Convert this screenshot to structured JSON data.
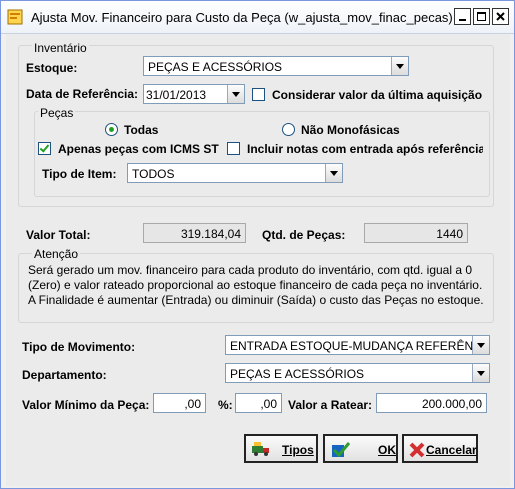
{
  "window": {
    "title": "Ajusta Mov. Financeiro para Custo da Peça (w_ajusta_mov_finac_pecas)"
  },
  "inventario": {
    "group_label": "Inventário",
    "estoque_label": "Estoque:",
    "estoque_value": "PEÇAS E ACESSÓRIOS",
    "data_ref_label": "Data de Referência:",
    "data_ref_value": "31/01/2013",
    "considerar_label": "Considerar valor da última aquisição",
    "considerar_checked": false
  },
  "pecas": {
    "group_label": "Peças",
    "todas_label": "Todas",
    "todas_selected": true,
    "nao_mono_label": "Não Monofásicas",
    "nao_mono_selected": false,
    "icms_label": "Apenas peças com ICMS ST",
    "icms_checked": true,
    "incluir_label": "Incluir notas com entrada após referência",
    "incluir_checked": false,
    "tipo_item_label": "Tipo de Item:",
    "tipo_item_value": "TODOS"
  },
  "totais": {
    "valor_total_label": "Valor Total:",
    "valor_total_value": "319.184,04",
    "qtd_pecas_label": "Qtd. de Peças:",
    "qtd_pecas_value": "1440"
  },
  "atencao": {
    "title": "Atenção",
    "message": "Será gerado um mov. financeiro para cada produto do inventário, com qtd. igual a 0 (Zero) e valor rateado proporcional ao estoque financeiro de cada peça no inventário. A Finalidade é aumentar (Entrada) ou diminuir (Saída) o custo das Peças no estoque."
  },
  "movimento": {
    "tipo_label": "Tipo de Movimento:",
    "tipo_value": "ENTRADA ESTOQUE-MUDANÇA REFERÊNCIA",
    "departamento_label": "Departamento:",
    "departamento_value": "PEÇAS E ACESSÓRIOS",
    "valor_minimo_label": "Valor Mínimo da Peça:",
    "valor_minimo_value": ",00",
    "percent_label": "%:",
    "percent_value": ",00",
    "valor_ratear_label": "Valor a Ratear:",
    "valor_ratear_value": "200.000,00"
  },
  "buttons": {
    "tipos": "Tipos",
    "ok": "OK",
    "cancelar": "Cancelar"
  },
  "icons": {
    "app": "app-window-icon",
    "tipos": "truck-icon",
    "ok": "check-icon",
    "cancelar": "cancel-icon"
  }
}
